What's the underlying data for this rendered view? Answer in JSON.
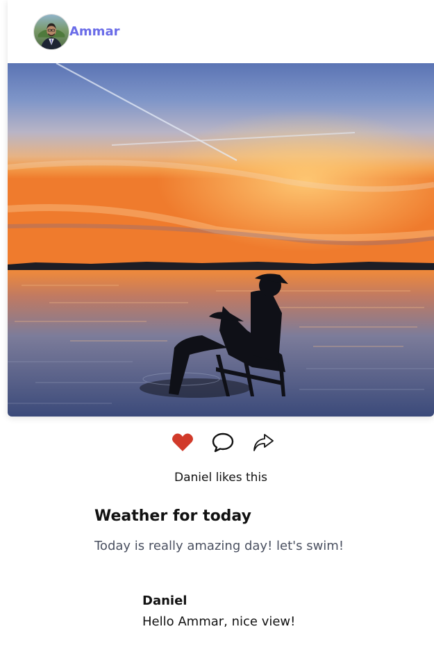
{
  "post": {
    "author": "Ammar",
    "title": "Weather for today",
    "body": "Today is really amazing day! let's swim!",
    "likes_text": "Daniel likes this"
  },
  "icons": {
    "like": "heart-icon",
    "comment": "speech-bubble-icon",
    "share": "share-arrow-icon"
  },
  "colors": {
    "author_name": "#6a6ce8",
    "liked_heart": "#d13a2a"
  },
  "comments": [
    {
      "author": "Daniel",
      "text": "Hello Ammar, nice view!"
    }
  ]
}
